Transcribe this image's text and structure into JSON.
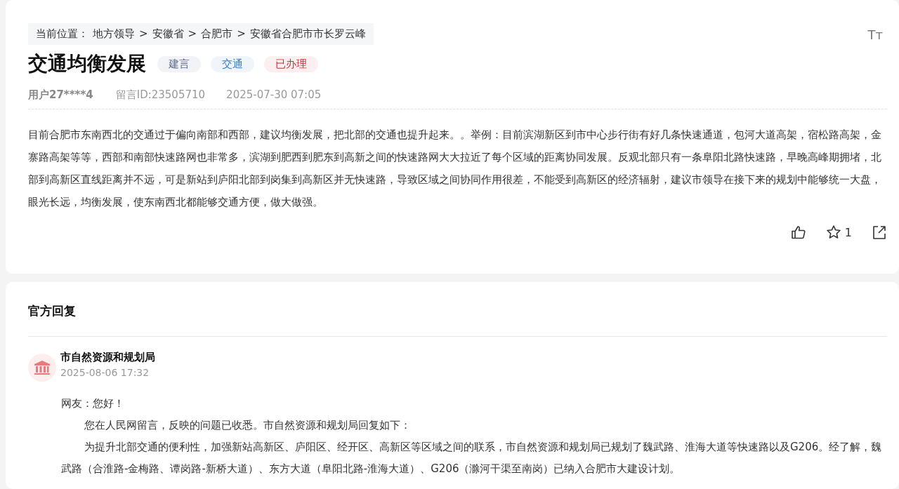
{
  "breadcrumb": {
    "label": "当前位置：",
    "items": [
      "地方领导",
      "安徽省",
      "合肥市",
      "安徽省合肥市市长罗云峰"
    ],
    "separator": ">"
  },
  "font_size_button": "Tт",
  "title": "交通均衡发展",
  "tags": [
    {
      "text": "建言",
      "color": "#5b6b8c"
    },
    {
      "text": "交通",
      "color": "#3a7bbf"
    },
    {
      "text": "已办理",
      "color": "#d0303a"
    }
  ],
  "meta": {
    "user": "用户27****4",
    "id": "留言ID:23505710",
    "time": "2025-07-30 07:05"
  },
  "body": "目前合肥市东南西北的交通过于偏向南部和西部，建议均衡发展，把北部的交通也提升起来。。举例：目前滨湖新区到市中心步行街有好几条快速通道，包河大道高架，宿松路高架，金寨路高架等等，西部和南部快速路网也非常多，滨湖到肥西到肥东到高新之间的快速路网大大拉近了每个区域的距离协同发展。反观北部只有一条阜阳北路快速路，早晚高峰期拥堵，北部到高新区直线距离并不远，可是新站到庐阳北部到岗集到高新区并无快速路，导致区域之间协同作用很差，不能受到高新区的经济辐射，建议市领导在接下来的规划中能够统一大盘，眼光长远，均衡发展，使东南西北都能够交通方便，做大做强。",
  "actions": {
    "favorites": "1"
  },
  "reply": {
    "heading": "官方回复",
    "office": "市自然资源和规划局",
    "time": "2025-08-06 17:32",
    "paragraphs": [
      {
        "kind": "plain",
        "text": "网友：您好！"
      },
      {
        "kind": "indent",
        "text": "您在人民网留言，反映的问题已收悉。市自然资源和规划局回复如下："
      },
      {
        "kind": "indent",
        "text": " 为提升北部交通的便利性，加强新站高新区、庐阳区、经开区、高新区等区域之间的联系，市自然资源和规划局已规划了魏武路、淮海大道等快速路以及G206。经了解，魏武路（合淮路-金梅路、谭岗路-新桥大道）、东方大道（阜阳北路-淮海大道）、G206（滁河干渠至南岗）已纳入合肥市大建设计划。"
      }
    ]
  }
}
